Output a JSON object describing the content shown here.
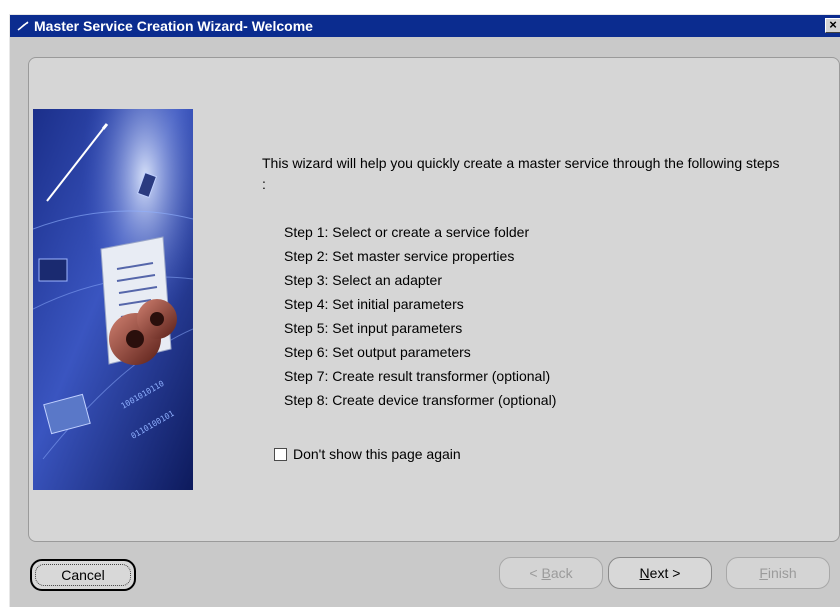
{
  "window": {
    "title": "Master Service Creation Wizard- Welcome",
    "close_label": "×"
  },
  "intro": {
    "text": "This wizard will help you quickly create a master service through the following steps :"
  },
  "steps": [
    "Step 1: Select or create a service folder",
    "Step 2: Set master service properties",
    "Step 3: Select an adapter",
    "Step 4: Set initial parameters",
    "Step 5: Set input parameters",
    "Step 6: Set output parameters",
    "Step 7: Create result transformer (optional)",
    "Step 8: Create device transformer (optional)"
  ],
  "checkbox": {
    "label": "Don't show this page again",
    "checked": false
  },
  "buttons": {
    "cancel": "Cancel",
    "back_mnemonic": "B",
    "back_rest": "ack",
    "back_arrow": "<",
    "next_mnemonic": "N",
    "next_rest": "ext",
    "next_arrow": ">",
    "finish_mnemonic": "F",
    "finish_rest": "inish"
  },
  "colors": {
    "titlebar": "#0b2c8f",
    "window_bg": "#c9c9c9",
    "panel_bg": "#d6d6d6"
  }
}
